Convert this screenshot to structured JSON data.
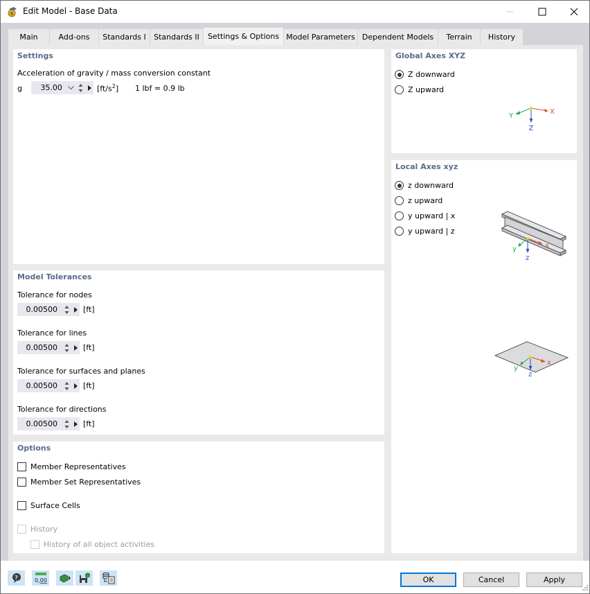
{
  "window": {
    "title": "Edit Model - Base Data",
    "icon": "rfem-app-icon",
    "controls": [
      "minimize-icon",
      "maximize-icon",
      "close-icon"
    ]
  },
  "tabs": [
    {
      "label": "Main",
      "active": false
    },
    {
      "label": "Add-ons",
      "active": false
    },
    {
      "label": "Standards I",
      "active": false
    },
    {
      "label": "Standards II",
      "active": false
    },
    {
      "label": "Settings & Options",
      "active": true
    },
    {
      "label": "Model Parameters",
      "active": false
    },
    {
      "label": "Dependent Models",
      "active": false
    },
    {
      "label": "Terrain",
      "active": false
    },
    {
      "label": "History",
      "active": false
    }
  ],
  "settings": {
    "title": "Settings",
    "gravity_label": "Acceleration of gravity / mass conversion constant",
    "g_symbol": "g",
    "g_value": "35.00",
    "g_unit": "[ft/s",
    "g_unit_sup": "2",
    "g_unit_close": "]",
    "conversion_text": "1 lbf = 0.9 lb"
  },
  "tolerances": {
    "title": "Model Tolerances",
    "items": [
      {
        "label": "Tolerance for nodes",
        "value": "0.00500",
        "unit": "[ft]"
      },
      {
        "label": "Tolerance for lines",
        "value": "0.00500",
        "unit": "[ft]"
      },
      {
        "label": "Tolerance for surfaces and planes",
        "value": "0.00500",
        "unit": "[ft]"
      },
      {
        "label": "Tolerance for directions",
        "value": "0.00500",
        "unit": "[ft]"
      }
    ]
  },
  "options": {
    "title": "Options",
    "items": [
      {
        "label": "Member Representatives",
        "checked": false,
        "enabled": true
      },
      {
        "label": "Member Set Representatives",
        "checked": false,
        "enabled": true
      },
      {
        "label": "Surface Cells",
        "checked": false,
        "enabled": true
      },
      {
        "label": "History",
        "checked": false,
        "enabled": false
      },
      {
        "label": "History of all object activities",
        "checked": false,
        "enabled": false
      }
    ]
  },
  "global_axes": {
    "title": "Global Axes XYZ",
    "options": [
      {
        "label": "Z downward",
        "selected": true
      },
      {
        "label": "Z upward",
        "selected": false
      }
    ],
    "axis_labels": {
      "x": "X",
      "y": "Y",
      "z": "Z"
    }
  },
  "local_axes": {
    "title": "Local Axes xyz",
    "options": [
      {
        "label": "z downward",
        "selected": true
      },
      {
        "label": "z upward",
        "selected": false
      },
      {
        "label": "y upward | x",
        "selected": false
      },
      {
        "label": "y upward | z",
        "selected": false
      }
    ],
    "axis_labels": {
      "x": "x",
      "y": "y",
      "z": "z"
    }
  },
  "colors": {
    "x_axis": "#d9502b",
    "y_axis": "#2fa84f",
    "z_axis": "#2155c4",
    "origin": "#f2d31b",
    "section_title": "#5a6b8c",
    "default_button_border": "#0078d7"
  },
  "footer": {
    "tools": [
      "help-icon",
      "units-decimals-icon",
      "model-transfer-icon",
      "save-settings-icon",
      "database-report-icon"
    ],
    "units_icon_text": "0,00",
    "ok": "OK",
    "cancel": "Cancel",
    "apply": "Apply"
  }
}
